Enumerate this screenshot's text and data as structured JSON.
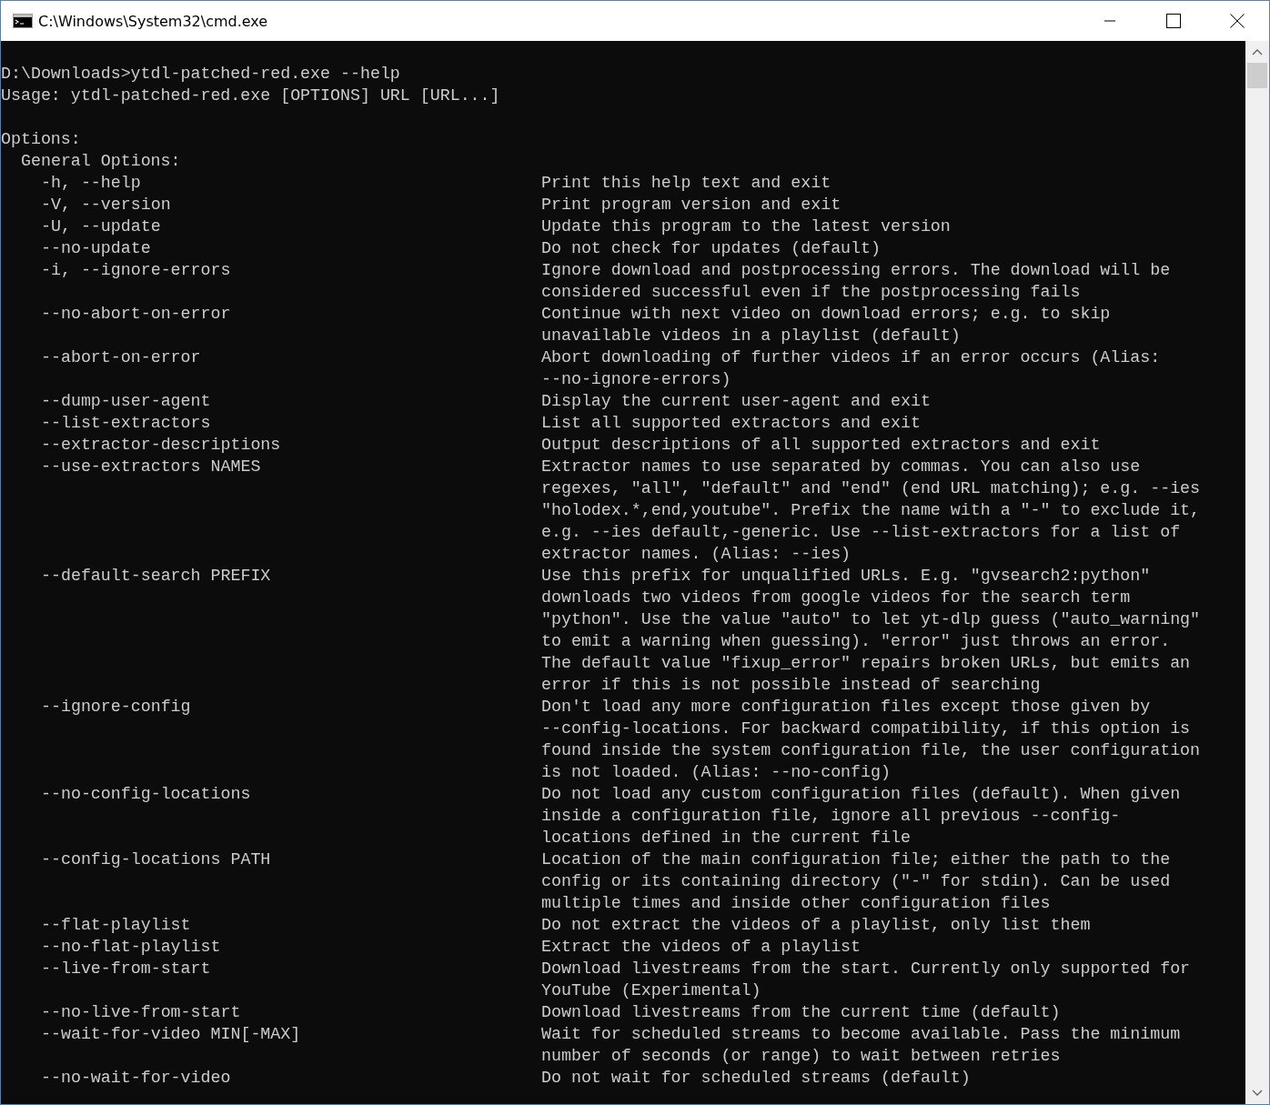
{
  "window": {
    "title": "C:\\Windows\\System32\\cmd.exe"
  },
  "console": {
    "command": "D:\\Downloads>ytdl-patched-red.exe --help",
    "usage": "Usage: ytdl-patched-red.exe [OPTIONS] URL [URL...]",
    "options_heading": "Options:",
    "group": "General Options:",
    "options": [
      {
        "flag": "-h, --help",
        "description": [
          "Print this help text and exit"
        ]
      },
      {
        "flag": "-V, --version",
        "description": [
          "Print program version and exit"
        ]
      },
      {
        "flag": "-U, --update",
        "description": [
          "Update this program to the latest version"
        ]
      },
      {
        "flag": "--no-update",
        "description": [
          "Do not check for updates (default)"
        ]
      },
      {
        "flag": "-i, --ignore-errors",
        "description": [
          "Ignore download and postprocessing errors. The download will be",
          "considered successful even if the postprocessing fails"
        ]
      },
      {
        "flag": "--no-abort-on-error",
        "description": [
          "Continue with next video on download errors; e.g. to skip",
          "unavailable videos in a playlist (default)"
        ]
      },
      {
        "flag": "--abort-on-error",
        "description": [
          "Abort downloading of further videos if an error occurs (Alias:",
          "--no-ignore-errors)"
        ]
      },
      {
        "flag": "--dump-user-agent",
        "description": [
          "Display the current user-agent and exit"
        ]
      },
      {
        "flag": "--list-extractors",
        "description": [
          "List all supported extractors and exit"
        ]
      },
      {
        "flag": "--extractor-descriptions",
        "description": [
          "Output descriptions of all supported extractors and exit"
        ]
      },
      {
        "flag": "--use-extractors NAMES",
        "description": [
          "Extractor names to use separated by commas. You can also use",
          "regexes, \"all\", \"default\" and \"end\" (end URL matching); e.g. --ies",
          "\"holodex.*,end,youtube\". Prefix the name with a \"-\" to exclude it,",
          "e.g. --ies default,-generic. Use --list-extractors for a list of",
          "extractor names. (Alias: --ies)"
        ]
      },
      {
        "flag": "--default-search PREFIX",
        "description": [
          "Use this prefix for unqualified URLs. E.g. \"gvsearch2:python\"",
          "downloads two videos from google videos for the search term",
          "\"python\". Use the value \"auto\" to let yt-dlp guess (\"auto_warning\"",
          "to emit a warning when guessing). \"error\" just throws an error.",
          "The default value \"fixup_error\" repairs broken URLs, but emits an",
          "error if this is not possible instead of searching"
        ]
      },
      {
        "flag": "--ignore-config",
        "description": [
          "Don't load any more configuration files except those given by",
          "--config-locations. For backward compatibility, if this option is",
          "found inside the system configuration file, the user configuration",
          "is not loaded. (Alias: --no-config)"
        ]
      },
      {
        "flag": "--no-config-locations",
        "description": [
          "Do not load any custom configuration files (default). When given",
          "inside a configuration file, ignore all previous --config-",
          "locations defined in the current file"
        ]
      },
      {
        "flag": "--config-locations PATH",
        "description": [
          "Location of the main configuration file; either the path to the",
          "config or its containing directory (\"-\" for stdin). Can be used",
          "multiple times and inside other configuration files"
        ]
      },
      {
        "flag": "--flat-playlist",
        "description": [
          "Do not extract the videos of a playlist, only list them"
        ]
      },
      {
        "flag": "--no-flat-playlist",
        "description": [
          "Extract the videos of a playlist"
        ]
      },
      {
        "flag": "--live-from-start",
        "description": [
          "Download livestreams from the start. Currently only supported for",
          "YouTube (Experimental)"
        ]
      },
      {
        "flag": "--no-live-from-start",
        "description": [
          "Download livestreams from the current time (default)"
        ]
      },
      {
        "flag": "--wait-for-video MIN[-MAX]",
        "description": [
          "Wait for scheduled streams to become available. Pass the minimum",
          "number of seconds (or range) to wait between retries"
        ]
      },
      {
        "flag": "--no-wait-for-video",
        "description": [
          "Do not wait for scheduled streams (default)"
        ]
      }
    ]
  }
}
